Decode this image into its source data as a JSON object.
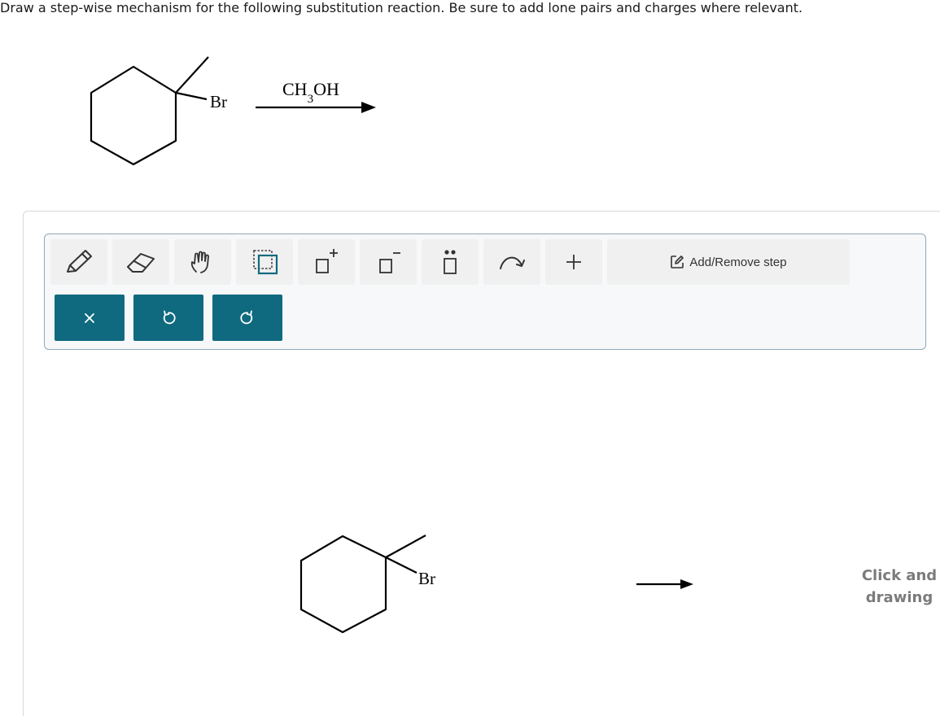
{
  "instruction": "Draw a step-wise mechanism for the following substitution reaction. Be sure to add lone pairs and charges where relevant.",
  "reaction": {
    "leaving_group_label": "Br",
    "reagent_main": "CH",
    "reagent_sub": "3",
    "reagent_tail": "OH"
  },
  "canvas": {
    "molecule_label": "Br",
    "hint_line1": "Click and",
    "hint_line2": "drawing"
  },
  "toolbar": {
    "tools": [
      {
        "id": "pencil",
        "icon": "pencil-icon"
      },
      {
        "id": "eraser",
        "icon": "eraser-icon"
      },
      {
        "id": "hand",
        "icon": "hand-icon"
      },
      {
        "id": "select",
        "icon": "select-box-icon"
      },
      {
        "id": "positive-charge",
        "icon": "positive-charge-icon"
      },
      {
        "id": "negative-charge",
        "icon": "negative-charge-icon"
      },
      {
        "id": "lone-pair",
        "icon": "lone-pair-icon"
      },
      {
        "id": "curved-arrow",
        "icon": "curved-arrow-icon"
      },
      {
        "id": "add",
        "icon": "plus-icon"
      }
    ],
    "step_label": "Add/Remove step",
    "actions": [
      {
        "id": "clear",
        "icon": "close-icon"
      },
      {
        "id": "undo",
        "icon": "undo-icon"
      },
      {
        "id": "redo",
        "icon": "redo-icon"
      }
    ]
  },
  "colors": {
    "action_bg": "#0f6a7f",
    "tool_bg": "#f0f0f0",
    "toolbar_border": "#8fa8b8",
    "hint_text": "#7b7b7b"
  }
}
